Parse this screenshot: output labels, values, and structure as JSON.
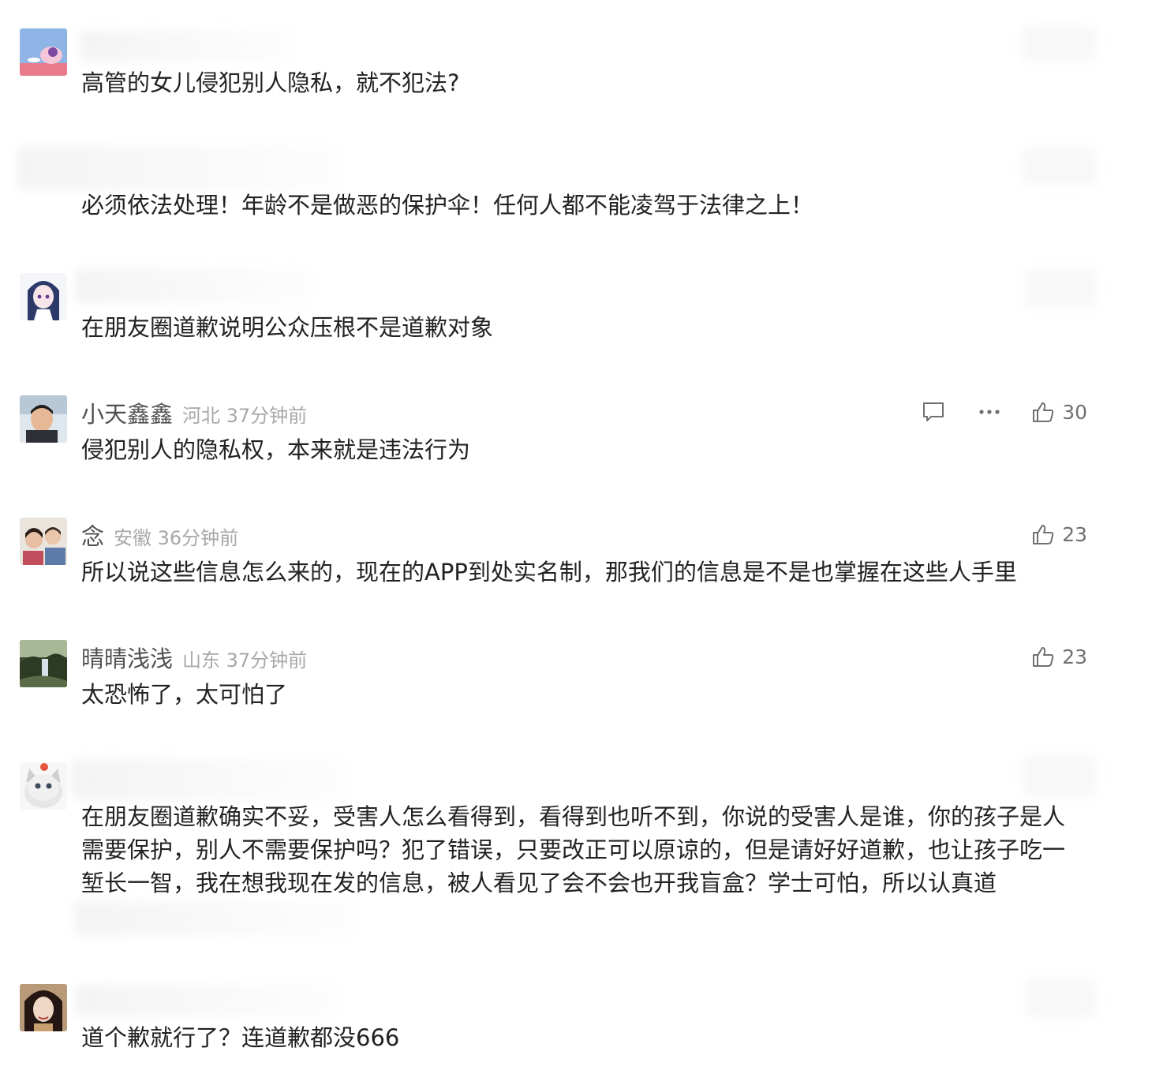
{
  "comments": [
    {
      "text": "高管的女儿侵犯别人隐私，就不犯法?"
    },
    {
      "text": "必须依法处理！年龄不是做恶的保护伞！任何人都不能凌驾于法律之上！"
    },
    {
      "text": "在朋友圈道歉说明公众压根不是道歉对象"
    },
    {
      "username": "小天鑫鑫",
      "location_time": "河北 37分钟前",
      "likes": "30",
      "text": "侵犯别人的隐私权，本来就是违法行为"
    },
    {
      "username": "念",
      "location_time": "安徽 36分钟前",
      "likes": "23",
      "text": "所以说这些信息怎么来的，现在的APP到处实名制，那我们的信息是不是也掌握在这些人手里"
    },
    {
      "username": "晴晴浅浅",
      "location_time": "山东 37分钟前",
      "likes": "23",
      "text": "太恐怖了，太可怕了"
    },
    {
      "text": "在朋友圈道歉确实不妥，受害人怎么看得到，看得到也听不到，你说的受害人是谁，你的孩子是人需要保护，别人不需要保护吗？犯了错误，只要改正可以原谅的，但是请好好道歉，也让孩子吃一堑长一智，我在想我现在发的信息，被人看见了会不会也开我盲盒？学士可怕，所以认真道"
    },
    {
      "text": "道个歉就行了？连道歉都没666"
    }
  ],
  "colors": {
    "text": "#222222",
    "username": "#505050",
    "meta": "#a8a8a8",
    "icon": "#707070"
  },
  "icons": {
    "reply": "comment-bubble-icon",
    "more": "more-dots-icon",
    "like": "thumbs-up-icon"
  }
}
